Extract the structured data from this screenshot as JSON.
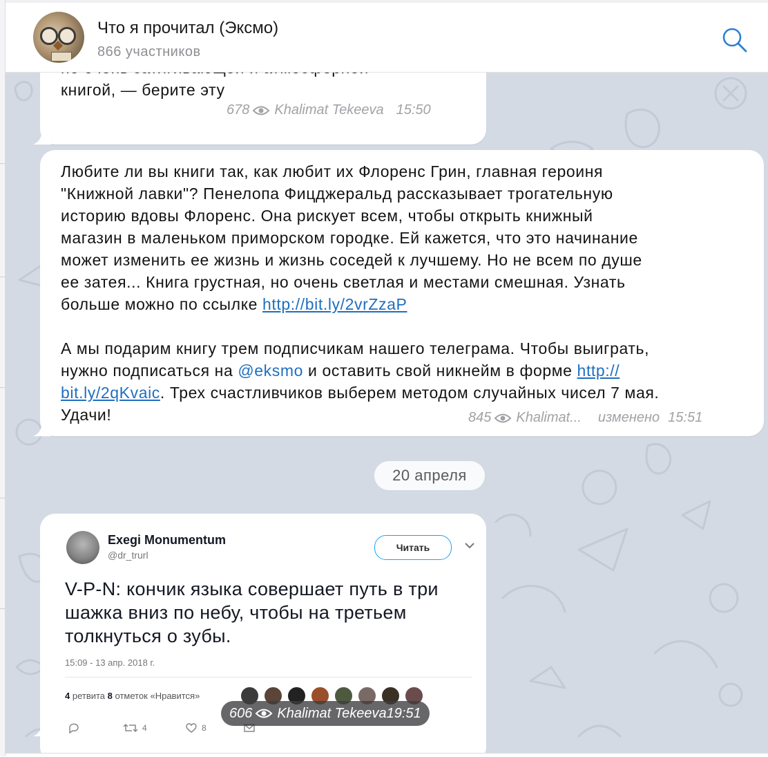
{
  "header": {
    "title": "Что я прочитал (Эксмо)",
    "subtitle": "866 участников"
  },
  "messages": [
    {
      "lines": [
        "но очень затягивающей и атмосферной",
        "книгой, — берите эту"
      ],
      "views": "678",
      "author": "Khalimat Tekeeva",
      "time": "15:50"
    },
    {
      "p1": [
        "Любите ли вы книги так, как любит их Флоренс Грин, главная героиня",
        "\"Книжной лавки\"? Пенелопа Фицджеральд рассказывает трогательную",
        "историю вдовы Флоренс. Она рискует всем, чтобы открыть книжный",
        "магазин в маленьком приморском городке. Ей кажется, что это начинание",
        "может изменить ее жизнь и жизнь соседей к лучшему. Но не всем по душе",
        "ее затея... Книга грустная, но очень светлая и местами смешная. Узнать"
      ],
      "p1_last_prefix": "больше можно по ссылке ",
      "link1": "http://bit.ly/2vrZzaP",
      "p2_line1": "А мы подарим книгу трем подписчикам нашего телеграма. Чтобы выиграть,",
      "p2_line2_prefix": "нужно подписаться на ",
      "mention": "@eksmo",
      "p2_line2_mid": " и оставить свой никнейм в форме ",
      "link2_part1": "http://",
      "link2_part2": "bit.ly/2qKvaic",
      "p2_line3_suffix": ". Трех счастливчиков выберем методом случайных чисел 7 мая.",
      "p2_line4": "Удачи!",
      "views": "845",
      "author": "Khalimat...",
      "edited": "изменено",
      "time": "15:51"
    },
    {
      "views": "606",
      "author": "Khalimat Tekeeva",
      "time": "19:51"
    }
  ],
  "date_separator": "20 апреля",
  "tweet": {
    "name": "Exegi Monumentum",
    "handle": "@dr_trurl",
    "follow_label": "Читать",
    "text": [
      "V-P-N: кончик языка совершает путь в три",
      "шажка вниз по небу, чтобы на третьем",
      "толкнуться о зубы."
    ],
    "date": "15:09 - 13 апр. 2018 г.",
    "retweets_count": "4",
    "retweets_label": " ретвита  ",
    "likes_count": "8",
    "likes_label": " отметок «Нравится»",
    "action_retweet_count": "4",
    "action_like_count": "8"
  },
  "colors": {
    "link": "#1f6fbf",
    "chat_background": "#d4dae4",
    "meta_gray": "#a2a2a7",
    "follow_border": "#1da1f2"
  }
}
